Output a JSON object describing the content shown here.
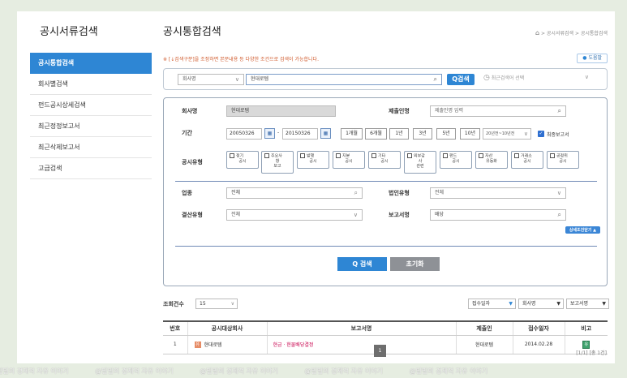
{
  "sidebar": {
    "title": "공시서류검색",
    "items": [
      {
        "label": "공시통합검색",
        "active": true
      },
      {
        "label": "회사별검색"
      },
      {
        "label": "펀드공시상세검색"
      },
      {
        "label": "최근정정보고서"
      },
      {
        "label": "최근삭제보고서"
      },
      {
        "label": "고급검색"
      }
    ]
  },
  "main": {
    "title": "공시통합검색",
    "breadcrumb": [
      "공시서류검색",
      "공시통합검색"
    ],
    "notice": "※ [↓검색구분]을 조정하면 본문내용 등 다양한 조건으로 검색이 가능합니다.",
    "help_label": "도움말"
  },
  "topbar": {
    "category": "회사명",
    "query": "현대로템",
    "search_label": "Q검색",
    "recent_placeholder": "최근검색어 선택"
  },
  "filters": {
    "company_label": "회사명",
    "company_value": "현대로템",
    "submitter_label": "제출인명",
    "submitter_placeholder": "제출인명 입력",
    "period_label": "기간",
    "date_from": "20050326",
    "date_to": "20150326",
    "period_buttons": [
      "1개월",
      "6개월",
      "1년",
      "3년",
      "5년",
      "10년"
    ],
    "period_select": "20년전~10년전",
    "latest_report_label": "최종보고서",
    "type_label": "공시유형",
    "types": [
      [
        "정기",
        "공시"
      ],
      [
        "주요사",
        "항",
        "보고"
      ],
      [
        "발행",
        "공시"
      ],
      [
        "지분",
        "공시"
      ],
      [
        "기타",
        "공시"
      ],
      [
        "외부감",
        "사",
        "관련"
      ],
      [
        "펀드",
        "공시"
      ],
      [
        "자산",
        "유동화"
      ],
      [
        "거래소",
        "공시"
      ],
      [
        "공정위",
        "공시"
      ]
    ],
    "industry_label": "업종",
    "industry_value": "전체",
    "corp_type_label": "법인유형",
    "corp_type_value": "전체",
    "settlement_label": "결산유형",
    "settlement_value": "전체",
    "report_name_label": "보고서명",
    "report_name_value": "배당",
    "detail_toggle": "상세조건닫기 ▲",
    "search_button": "Q 검색",
    "reset_button": "초기화"
  },
  "results": {
    "count_label": "조회건수",
    "count_value": "15",
    "sort_options": [
      "접수일자",
      "회사명",
      "보고서명"
    ],
    "columns": [
      "번호",
      "공시대상회사",
      "보고서명",
      "제출인",
      "접수일자",
      "비고"
    ],
    "rows": [
      {
        "no": "1",
        "company": "현대로템",
        "report": "현금 · 현물배당결정",
        "submitter": "현대로템",
        "date": "2014.02.28",
        "note": "유"
      }
    ],
    "page": "1",
    "page_info": "[1/1] [총 1건]"
  },
  "watermark": [
    "@빌빌의 경제적 자유 이야기",
    "@빌빌의 경제적 자유 이야기",
    "@빌빌의 경제적 자유 이야기",
    "@빌빌의 경제적 자유 이야기",
    "@빌빌의 경제적 자유 이야기"
  ],
  "colors": {
    "accent": "#2e86d4",
    "background": "#e6ede1",
    "link": "#c8004c"
  }
}
